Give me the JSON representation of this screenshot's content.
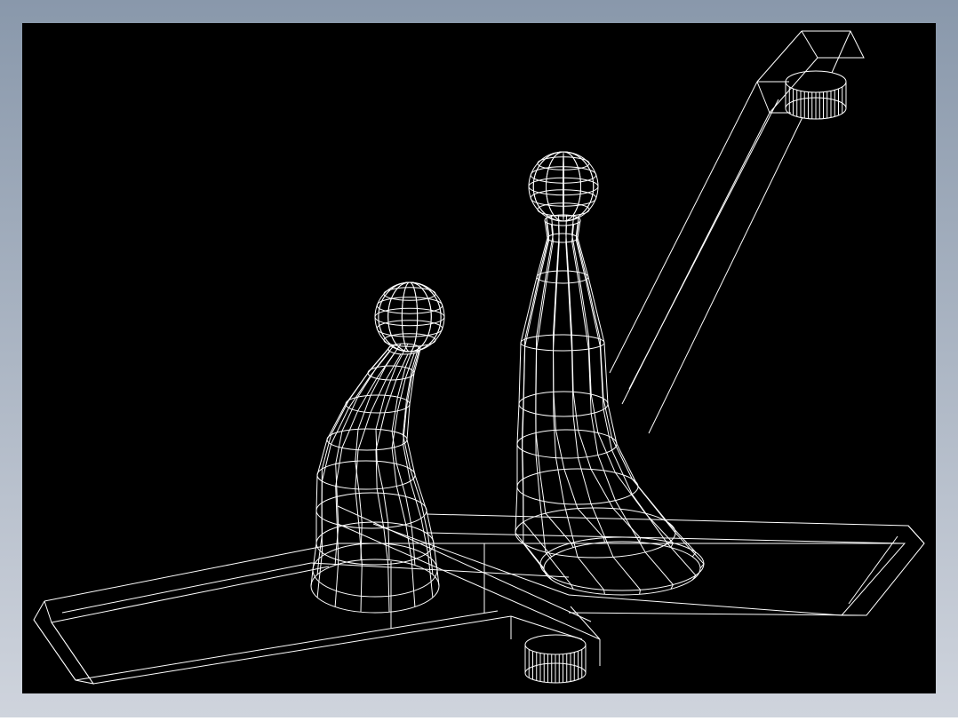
{
  "colors": {
    "frame_gradient_top": "#8998ab",
    "frame_gradient_bottom": "#cfd4dd",
    "viewport_background": "#000000",
    "wireframe_stroke": "#ffffff"
  },
  "viewport": {
    "render_mode": "wireframe",
    "background": "black"
  },
  "model": {
    "parts": [
      "base-plate",
      "diagonal-arm",
      "top-boss",
      "bottom-boss",
      "tall-column",
      "column-knob",
      "short-column",
      "short-column-knob"
    ]
  }
}
